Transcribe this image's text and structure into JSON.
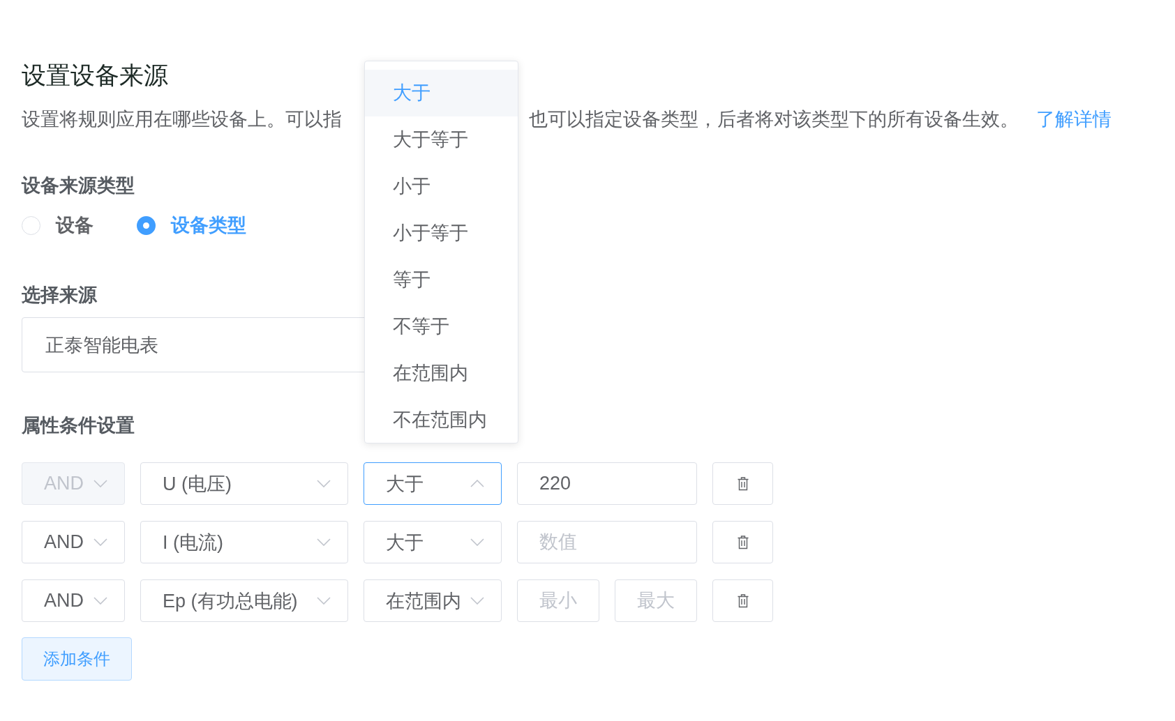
{
  "header": {
    "title": "设置设备来源",
    "description_start": "设置将规则应用在哪些设备上。可以指",
    "description_end": "也可以指定设备类型，后者将对该类型下的所有设备生效。",
    "link": "了解详情"
  },
  "source_type": {
    "label": "设备来源类型",
    "options": [
      {
        "label": "设备",
        "selected": false
      },
      {
        "label": "设备类型",
        "selected": true
      }
    ]
  },
  "source_select": {
    "label": "选择来源",
    "value": "正泰智能电表"
  },
  "conditions": {
    "label": "属性条件设置",
    "rows": [
      {
        "logic": {
          "value": "AND",
          "disabled": true
        },
        "property": {
          "value": "U (电压)"
        },
        "operator": {
          "value": "大于",
          "expanded": true
        },
        "inputs": [
          {
            "value": "220"
          }
        ]
      },
      {
        "logic": {
          "value": "AND",
          "disabled": false
        },
        "property": {
          "value": "I (电流)"
        },
        "operator": {
          "value": "大于",
          "expanded": false
        },
        "inputs": [
          {
            "placeholder": "数值"
          }
        ]
      },
      {
        "logic": {
          "value": "AND",
          "disabled": false
        },
        "property": {
          "value": "Ep (有功总电能)"
        },
        "operator": {
          "value": "在范围内",
          "expanded": false
        },
        "inputs": [
          {
            "placeholder": "最小"
          },
          {
            "placeholder": "最大"
          }
        ]
      }
    ],
    "add_button": "添加条件"
  },
  "operator_dropdown": {
    "items": [
      {
        "label": "大于",
        "selected": true
      },
      {
        "label": "大于等于",
        "selected": false
      },
      {
        "label": "小于",
        "selected": false
      },
      {
        "label": "小于等于",
        "selected": false
      },
      {
        "label": "等于",
        "selected": false
      },
      {
        "label": "不等于",
        "selected": false
      },
      {
        "label": "在范围内",
        "selected": false
      },
      {
        "label": "不在范围内",
        "selected": false
      }
    ]
  }
}
